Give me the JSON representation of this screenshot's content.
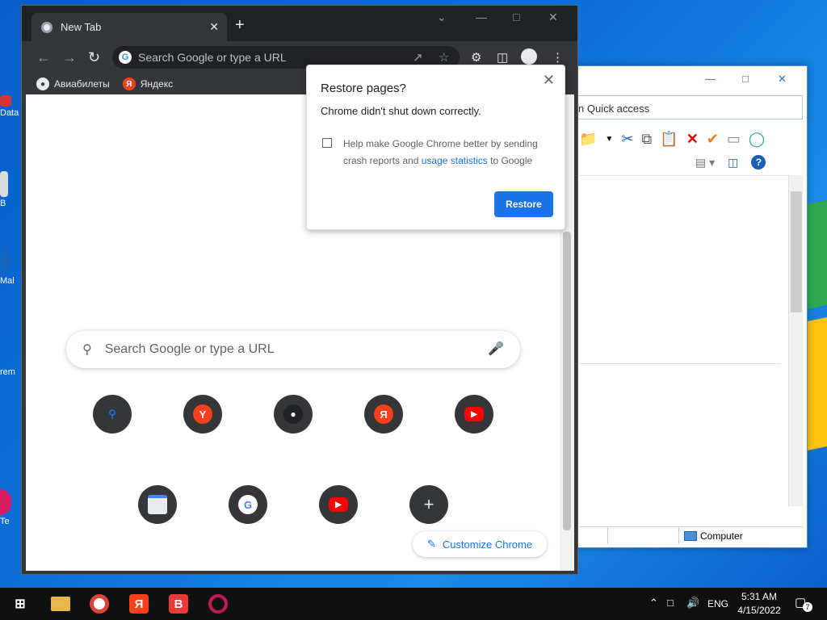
{
  "desktop": {
    "icons": [
      {
        "label": "Data"
      },
      {
        "label": "B"
      },
      {
        "label": "Mal"
      },
      {
        "label": "rem"
      },
      {
        "label": "Te"
      }
    ]
  },
  "explorer": {
    "address": "n Quick access",
    "status_computer": "Computer",
    "colors": {
      "accent": "#4a90d9"
    }
  },
  "chrome": {
    "tab_title": "New Tab",
    "omnibox_placeholder": "Search Google or type a URL",
    "bookmarks": [
      {
        "label": "Авиабилеты",
        "icon": "globe-icon"
      },
      {
        "label": "Яндекс",
        "icon": "yandex-icon"
      }
    ],
    "ntp": {
      "search_placeholder": "Search Google or type a URL",
      "customize_label": "Customize Chrome",
      "shortcuts_row1": [
        {
          "icon": "search-icon",
          "color": "#1a73e8"
        },
        {
          "icon": "yandex-y-icon",
          "color": "#fc3f1d"
        },
        {
          "icon": "github-icon",
          "color": "#202124"
        },
        {
          "icon": "yandex-ya-icon",
          "color": "#fc3f1d"
        },
        {
          "icon": "youtube-icon",
          "color": "#ff0000"
        }
      ],
      "shortcuts_row2": [
        {
          "icon": "web-store-icon",
          "color": "#4285f4"
        },
        {
          "icon": "google-icon",
          "color": "#4285f4"
        },
        {
          "icon": "youtube-icon",
          "color": "#ff0000"
        },
        {
          "icon": "add-shortcut-icon",
          "color": "#35363a"
        }
      ]
    },
    "colors": {
      "frame": "#202124",
      "toolbar": "#35363a",
      "accent": "#1a73e8"
    }
  },
  "dialog": {
    "title": "Restore pages?",
    "message": "Chrome didn't shut down correctly.",
    "help_text_1": "Help make Google Chrome better by sending crash reports and",
    "help_link": "usage statistics",
    "help_text_2": "to Google",
    "restore_label": "Restore"
  },
  "taskbar": {
    "apps": [
      "file-explorer-icon",
      "chrome-icon",
      "yandex-icon",
      "vivaldi-icon",
      "opera-icon"
    ],
    "language": "ENG",
    "time": "5:31 AM",
    "date": "4/15/2022",
    "notification_count": "7"
  }
}
